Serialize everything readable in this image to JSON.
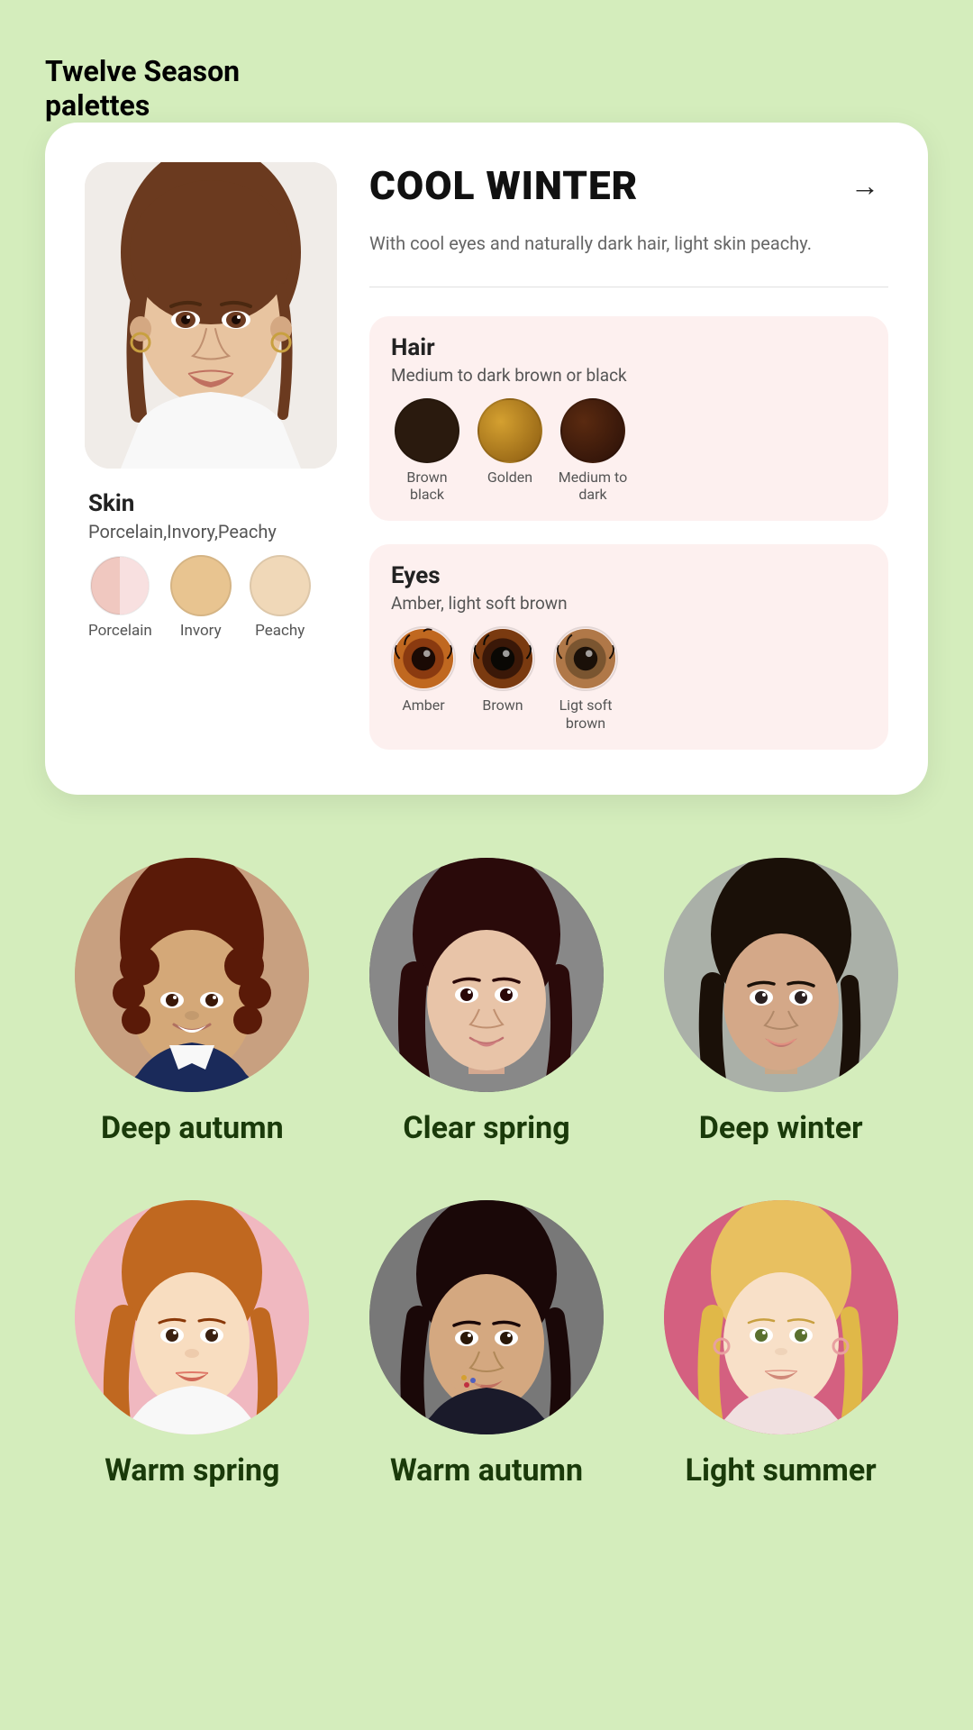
{
  "page": {
    "title_line1": "Twelve Season",
    "title_line2": "palettes"
  },
  "card": {
    "season_name": "COOL WINTER",
    "arrow": "→",
    "description": "With cool eyes and naturally dark hair, light skin peachy.",
    "hair": {
      "title": "Hair",
      "subtitle": "Medium to dark brown or black",
      "swatches": [
        {
          "label": "Brown black",
          "color": "#2a1a0e"
        },
        {
          "label": "Golden",
          "color": "#b5852a"
        },
        {
          "label": "Medium\nto dark",
          "color": "#3d1f0e"
        }
      ]
    },
    "eyes": {
      "title": "Eyes",
      "subtitle": "Amber, light soft brown",
      "swatches": [
        {
          "label": "Amber",
          "color_outer": "#7a3a0a",
          "color_inner": "#c06820",
          "color_center": "#1a1008"
        },
        {
          "label": "Brown",
          "color_outer": "#3a1a08",
          "color_inner": "#7a3a10",
          "color_center": "#0a0804"
        },
        {
          "label": "Ligt soft\nbrown",
          "color_outer": "#7a5530",
          "color_inner": "#b07848",
          "color_center": "#1a1008"
        }
      ]
    },
    "skin": {
      "title": "Skin",
      "subtitle": "Porcelain,Invory,Peachy",
      "swatches": [
        {
          "label": "Porcelain",
          "color": "#f0c8c0",
          "split": true
        },
        {
          "label": "Invory",
          "color": "#e8c490"
        },
        {
          "label": "Peachy",
          "color": "#f0d8b8"
        }
      ]
    }
  },
  "seasons": {
    "row1": [
      {
        "name": "Deep autumn",
        "bg": "#c8a080"
      },
      {
        "name": "Clear spring",
        "bg": "#5a5a5a"
      },
      {
        "name": "Deep winter",
        "bg": "#888a88"
      }
    ],
    "row2": [
      {
        "name": "Warm spring",
        "bg": "#f0b8c0"
      },
      {
        "name": "Warm autumn",
        "bg": "#6a6a6a"
      },
      {
        "name": "Light summer",
        "bg": "#d46080"
      }
    ]
  }
}
